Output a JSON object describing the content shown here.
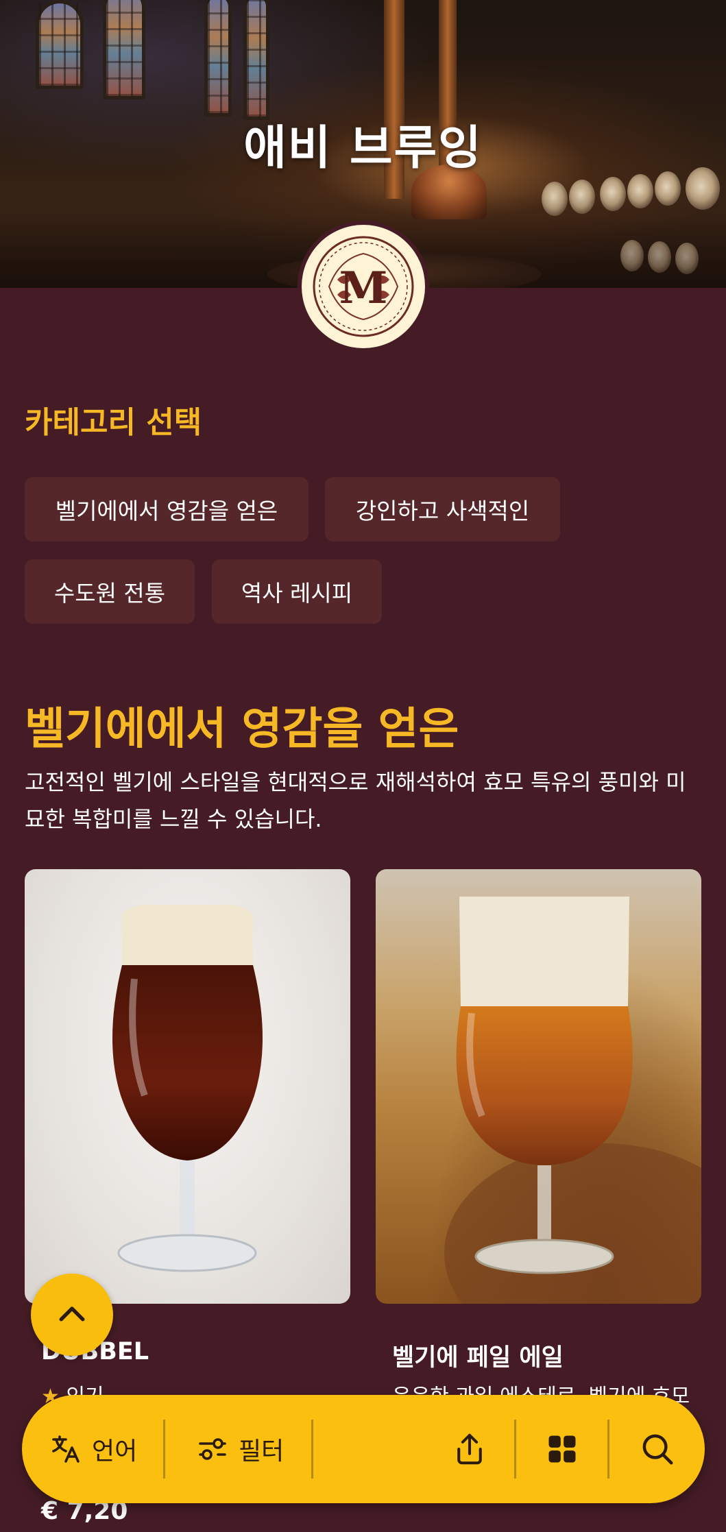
{
  "hero": {
    "title": "애비 브루잉"
  },
  "categories": {
    "heading": "카테고리 선택",
    "chips": [
      "벨기에에서 영감을 얻은",
      "강인하고 사색적인",
      "수도원 전통",
      "역사 레시피"
    ]
  },
  "section": {
    "title": "벨기에에서 영감을 얻은",
    "description": "고전적인 벨기에 스타일을 현대적으로 재해석하여 효모 특유의 풍미와 미묘한 복합미를 느낄 수 있습니다."
  },
  "products": [
    {
      "name": "DUBBEL",
      "badge": "인기",
      "price": "€ 7,20"
    },
    {
      "name": "벨기에 페일 에일",
      "description": "은은한 과일 에스테르, 벨기에 효모"
    }
  ],
  "bottom_bar": {
    "language_label": "언어",
    "filter_label": "필터",
    "icons": [
      "translate-icon",
      "filter-icon",
      "share-icon",
      "grid-icon",
      "search-icon"
    ]
  },
  "colors": {
    "background": "#451c25",
    "accent": "#f7b825",
    "chip": "#56272a",
    "bar": "#fbbf10"
  }
}
